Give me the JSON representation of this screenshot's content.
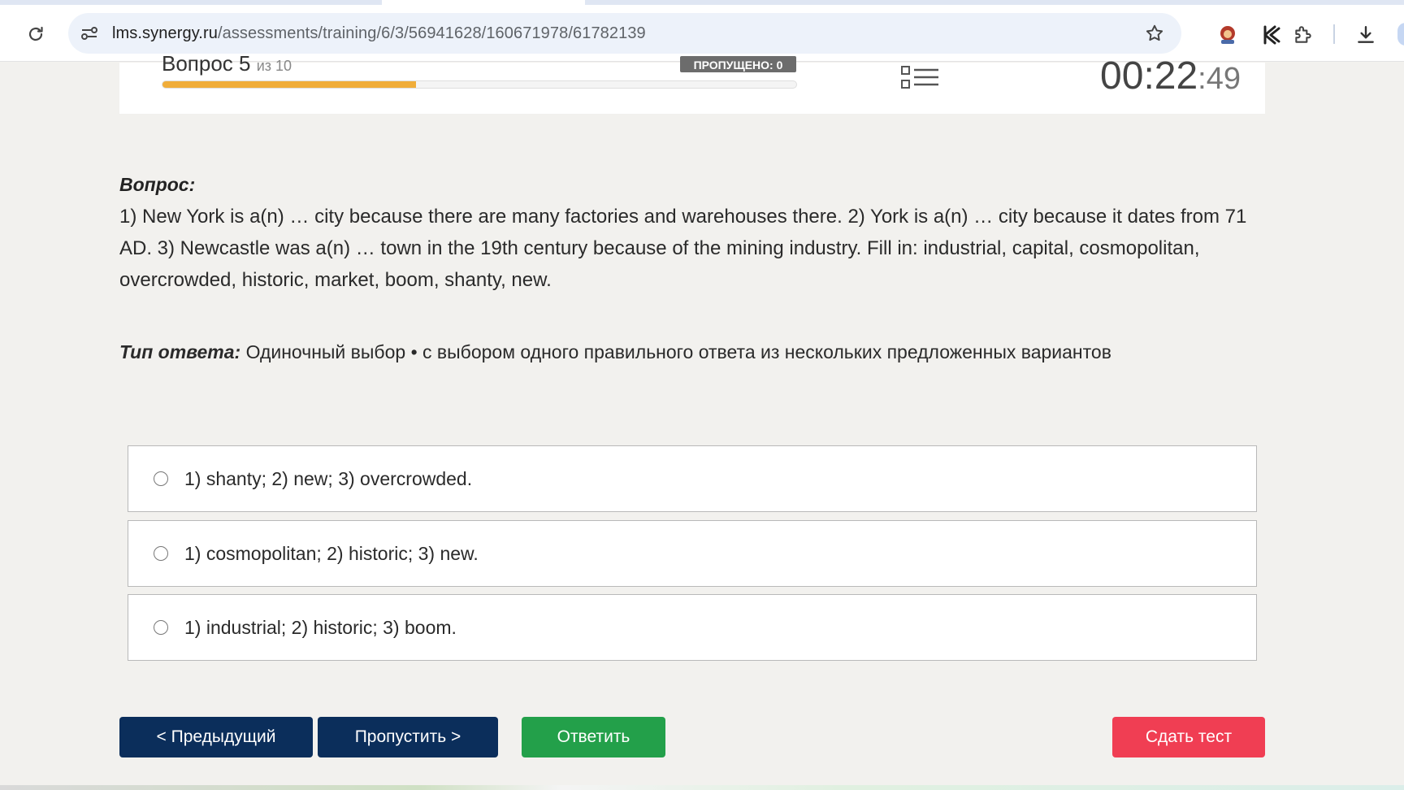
{
  "browser": {
    "url_host": "lms.synergy.ru",
    "url_path": "/assessments/training/6/3/56941628/160671978/61782139"
  },
  "header": {
    "question_counter": "Вопрос 5",
    "question_of": "из 10",
    "skipped_badge": "ПРОПУЩЕНО: 0",
    "progress_fraction": 0.4,
    "timer_main": "00:22",
    "timer_seconds": ":49"
  },
  "question": {
    "label": "Вопрос:",
    "text": "1) New York is a(n) … city because there are many factories and warehouses there. 2) York is a(n) … city because it dates from 71 AD. 3) Newcastle was a(n) … town in the 19th century because of the mining industry. Fill in: industrial, capital, cosmopolitan, overcrowded, historic, market, boom, shanty, new.",
    "answer_type_label": "Тип ответа:",
    "answer_type_value": "Одиночный выбор • с выбором одного правильного ответа из нескольких предложенных вариантов"
  },
  "options": [
    {
      "text": "1) shanty; 2) new; 3) overcrowded."
    },
    {
      "text": "1) cosmopolitan; 2) historic; 3) new."
    },
    {
      "text": "1) industrial; 2) historic; 3) boom."
    }
  ],
  "buttons": {
    "prev": "< Предыдущий",
    "skip": "Пропустить >",
    "answer": "Ответить",
    "finish": "Сдать тест"
  },
  "colors": {
    "primary_navy": "#0b2e5b",
    "answer_green": "#23a04a",
    "finish_red": "#f03e53",
    "progress_orange": "#f0ad3a"
  }
}
